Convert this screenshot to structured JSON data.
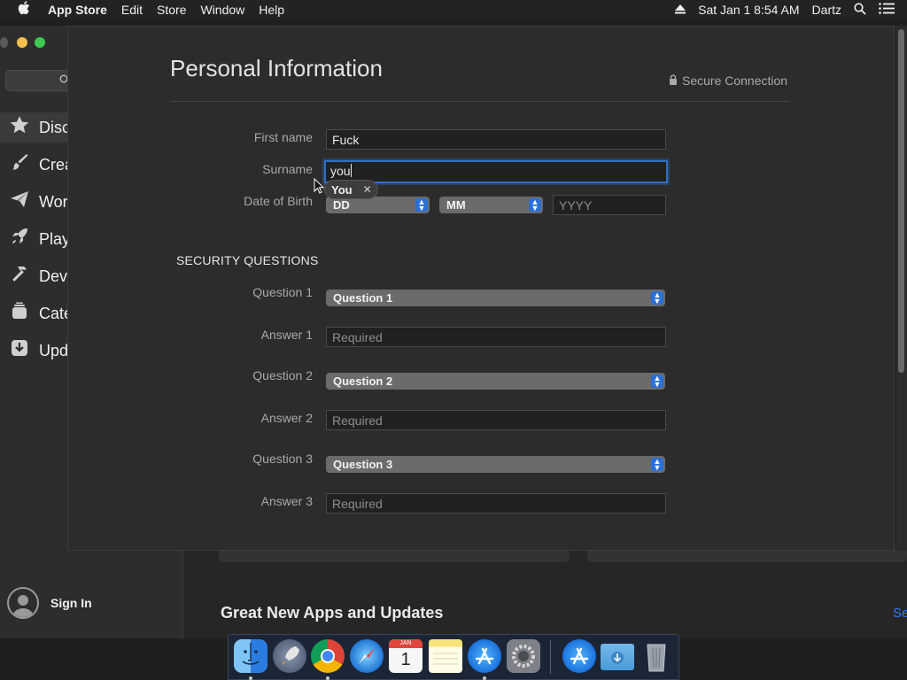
{
  "menubar": {
    "app": "App Store",
    "items": [
      "Edit",
      "Store",
      "Window",
      "Help"
    ],
    "datetime": "Sat Jan 1  8:54 AM",
    "user": "Dartz"
  },
  "sidebar": {
    "items": [
      {
        "label": "Disc",
        "icon": "star-icon"
      },
      {
        "label": "Crea",
        "icon": "brush-icon"
      },
      {
        "label": "Wor",
        "icon": "paper-plane-icon"
      },
      {
        "label": "Play",
        "icon": "rocket-icon"
      },
      {
        "label": "Dev",
        "icon": "hammer-icon"
      },
      {
        "label": "Cate",
        "icon": "stack-icon"
      },
      {
        "label": "Upd",
        "icon": "download-icon"
      }
    ],
    "sign_in": "Sign In"
  },
  "background": {
    "section_title": "Great New Apps and Updates",
    "see_all": "Se"
  },
  "sheet": {
    "title": "Personal Information",
    "secure": "Secure Connection",
    "first_name": {
      "label": "First name",
      "value": "Fuck"
    },
    "surname": {
      "label": "Surname",
      "value": "you"
    },
    "autocomplete": "You",
    "dob": {
      "label": "Date of Birth",
      "day": "DD",
      "month": "MM",
      "year_placeholder": "YYYY"
    },
    "security_header": "SECURITY QUESTIONS",
    "questions": [
      {
        "q_label": "Question 1",
        "q_value": "Question 1",
        "a_label": "Answer 1",
        "a_placeholder": "Required"
      },
      {
        "q_label": "Question 2",
        "q_value": "Question 2",
        "a_label": "Answer 2",
        "a_placeholder": "Required"
      },
      {
        "q_label": "Question 3",
        "q_value": "Question 3",
        "a_label": "Answer 3",
        "a_placeholder": "Required"
      }
    ]
  },
  "dock": {
    "apps": [
      "finder-icon",
      "launchpad-icon",
      "chrome-icon",
      "safari-icon",
      "calendar-icon",
      "notes-icon",
      "app-store-icon",
      "system-preferences-icon",
      "app-store-downloads-icon",
      "downloads-folder-icon",
      "trash-icon"
    ],
    "calendar_month": "JAN",
    "calendar_day": "1"
  },
  "colors": {
    "accent": "#2f70c6",
    "popup": "#6b6b6b",
    "sheet_bg": "#2c2c2c"
  }
}
